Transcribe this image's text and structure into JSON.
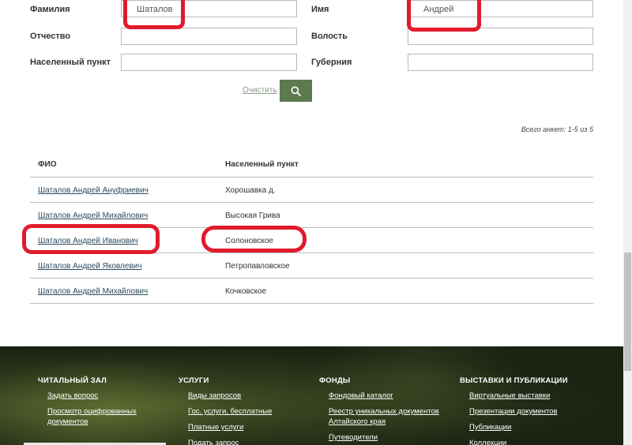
{
  "form": {
    "surname_label": "Фамилия",
    "surname_value": "Шаталов",
    "name_label": "Имя",
    "name_value": "Андрей",
    "patronymic_label": "Отчество",
    "patronymic_value": "",
    "volost_label": "Волость",
    "volost_value": "",
    "settlement_label": "Населенный пункт",
    "settlement_value": "",
    "province_label": "Губерния",
    "province_value": "",
    "clear_label": "Очистить",
    "search_icon": "search-icon"
  },
  "results": {
    "total": "Всего анкет: 1-5 из 5",
    "columns": [
      "ФИО",
      "Населенный пункт"
    ],
    "rows": [
      {
        "name": "Шаталов Андрей Ануфриевич",
        "place": "Хорошавка д."
      },
      {
        "name": "Шаталов Андрей Михайлович",
        "place": "Высокая Грива"
      },
      {
        "name": "Шаталов Андрей Иванович",
        "place": "Солоновское"
      },
      {
        "name": "Шаталов Андрей Яковлевич",
        "place": "Петропавловское"
      },
      {
        "name": "Шаталов Андрей Михайлович",
        "place": "Кочковское"
      }
    ]
  },
  "footer": {
    "columns": [
      {
        "title": "ЧИТАЛЬНЫЙ ЗАЛ",
        "links": [
          "Задать вопрос",
          "Просмотр оцифрованных документов"
        ]
      },
      {
        "title": "УСЛУГИ",
        "links": [
          "Виды запросов",
          "Гос. услуги, бесплатные",
          "Платные услуги",
          "Подать запрос"
        ]
      },
      {
        "title": "ФОНДЫ",
        "links": [
          "Фондовый каталог",
          "Реестр уникальных документов Алтайского края",
          "Путеводители"
        ]
      },
      {
        "title": "ВЫСТАВКИ И ПУБЛИКАЦИИ",
        "links": [
          "Виртуальные выставки",
          "Презентации документов",
          "Публикации",
          "Коллекции"
        ]
      }
    ]
  },
  "colors": {
    "accent": "#5d7a4f",
    "highlight": "#e01b2c",
    "link": "#2b4a5e"
  }
}
